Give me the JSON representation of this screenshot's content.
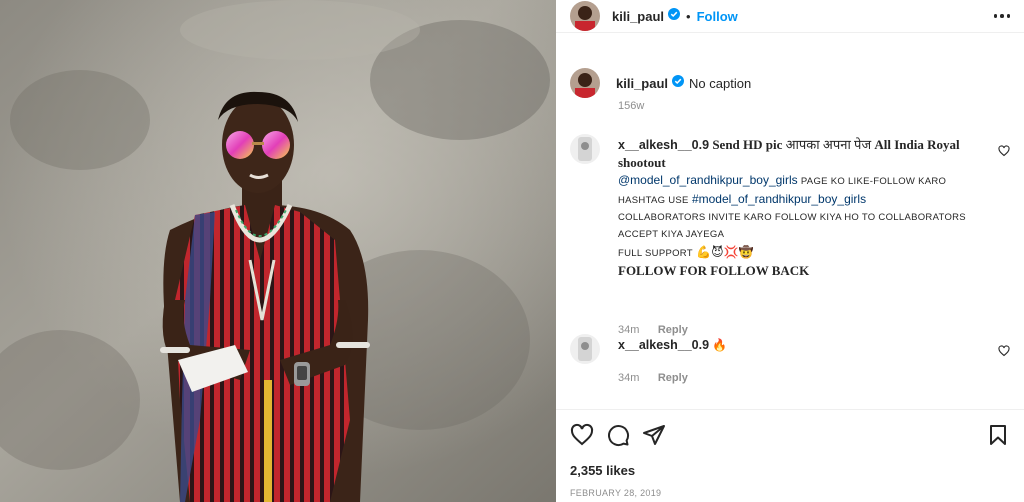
{
  "post": {
    "photo_icon": "person-wearing-sunglasses-and-red-shuka-photo"
  },
  "header": {
    "username": "kili_paul",
    "separator": "•",
    "follow_label": "Follow"
  },
  "caption": {
    "username": "kili_paul",
    "text": "No caption",
    "time": "156w"
  },
  "comments": [
    {
      "username": "x__alkesh__0.9",
      "line1_a": "Send HD pic",
      "line1_b": "आपका अपना पेज",
      "line1_c": "All India Royal",
      "line2": "shootout",
      "mention": "@model_of_randhikpur_boy_girls",
      "line3_rest": "page ko like-follow karo",
      "line4_a": "hashtag use",
      "hashtag": "#model_of_randhikpur_boy_girls",
      "line5": "collaborators invite karo follow kiya ho to collaborators",
      "line6": "accept kiya jayega",
      "line7": "full support",
      "line7_emoji": "💪😈💢🤠",
      "line8": "FOLLOW FOR FOLLOW BACK",
      "time": "34m",
      "reply": "Reply"
    },
    {
      "username": "x__alkesh__0.9",
      "emoji": "🔥",
      "time": "34m",
      "reply": "Reply"
    }
  ],
  "actions": {
    "like_icon": "heart-icon",
    "comment_icon": "comment-icon",
    "share_icon": "send-icon",
    "save_icon": "bookmark-icon"
  },
  "likes": "2,355 likes",
  "date": "FEBRUARY 28, 2019",
  "colors": {
    "link": "#00376b",
    "follow": "#0095f6",
    "muted": "#8e8e8e"
  }
}
